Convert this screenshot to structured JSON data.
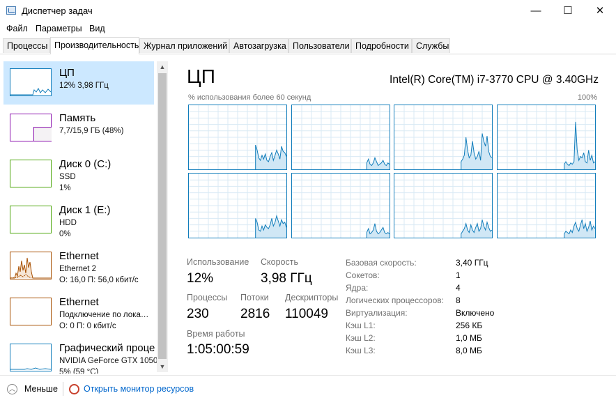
{
  "window": {
    "title": "Диспетчер задач",
    "minimize": "—",
    "maximize": "☐",
    "close": "✕"
  },
  "menu": [
    "Файл",
    "Параметры",
    "Вид"
  ],
  "tabs": [
    "Процессы",
    "Производительность",
    "Журнал приложений",
    "Автозагрузка",
    "Пользователи",
    "Подробности",
    "Службы"
  ],
  "active_tab": "Производительность",
  "sidebar": [
    {
      "title": "ЦП",
      "line1": "12% 3,98 ГГц",
      "line2": "",
      "color": "#117dbb",
      "selected": true
    },
    {
      "title": "Память",
      "line1": "7,7/15,9 ГБ (48%)",
      "line2": "",
      "color": "#8b12ae",
      "selected": false
    },
    {
      "title": "Диск 0 (C:)",
      "line1": "SSD",
      "line2": "1%",
      "color": "#4da60c",
      "selected": false
    },
    {
      "title": "Диск 1 (E:)",
      "line1": "HDD",
      "line2": "0%",
      "color": "#4da60c",
      "selected": false
    },
    {
      "title": "Ethernet",
      "line1": "Ethernet 2",
      "line2": "О: 16,0 П: 56,0 кбит/с",
      "color": "#a74f01",
      "selected": false
    },
    {
      "title": "Ethernet",
      "line1": "Подключение по лока…",
      "line2": "О: 0 П: 0 кбит/с",
      "color": "#a74f01",
      "selected": false
    },
    {
      "title": "Графический проце",
      "line1": "NVIDIA GeForce GTX 1050",
      "line2": "5% (59 °C)",
      "color": "#117dbb",
      "selected": false
    }
  ],
  "main": {
    "title": "ЦП",
    "model": "Intel(R) Core(TM) i7-3770 CPU @ 3.40GHz",
    "graph_caption": "% использования более 60 секунд",
    "graph_max": "100%",
    "stats": {
      "usage_label": "Использование",
      "usage_value": "12%",
      "speed_label": "Скорость",
      "speed_value": "3,98 ГГц",
      "processes_label": "Процессы",
      "processes_value": "230",
      "threads_label": "Потоки",
      "threads_value": "2816",
      "handles_label": "Дескрипторы",
      "handles_value": "110049",
      "uptime_label": "Время работы",
      "uptime_value": "1:05:00:59"
    },
    "details": [
      {
        "k": "Базовая скорость:",
        "v": "3,40 ГГц"
      },
      {
        "k": "Сокетов:",
        "v": "1"
      },
      {
        "k": "Ядра:",
        "v": "4"
      },
      {
        "k": "Логических процессоров:",
        "v": "8"
      },
      {
        "k": "Виртуализация:",
        "v": "Включено"
      },
      {
        "k": "Кэш L1:",
        "v": "256 КБ"
      },
      {
        "k": "Кэш L2:",
        "v": "1,0 МБ"
      },
      {
        "k": "Кэш L3:",
        "v": "8,0 МБ"
      }
    ]
  },
  "footer": {
    "less": "Меньше",
    "monitor": "Открыть монитор ресурсов"
  },
  "colors": {
    "cpu": "#117dbb",
    "memory": "#8b12ae",
    "disk": "#4da60c",
    "ethernet": "#a74f01",
    "selected_bg": "#cce8ff",
    "link": "#0066cc"
  },
  "core_usage_percent": [
    [
      0,
      0,
      0,
      0,
      0,
      0,
      0,
      0,
      0,
      0,
      0,
      0,
      0,
      0,
      0,
      0,
      0,
      0,
      0,
      0,
      0,
      0,
      0,
      0,
      0,
      0,
      0,
      0,
      0,
      0,
      0,
      0,
      0,
      0,
      0,
      0,
      0,
      0,
      0,
      0,
      0,
      38,
      30,
      18,
      14,
      22,
      16,
      24,
      14,
      12,
      20,
      26,
      14,
      22,
      30,
      24,
      16,
      36,
      28,
      26,
      20
    ],
    [
      0,
      0,
      0,
      0,
      0,
      0,
      0,
      0,
      0,
      0,
      0,
      0,
      0,
      0,
      0,
      0,
      0,
      0,
      0,
      0,
      0,
      0,
      0,
      0,
      0,
      0,
      0,
      0,
      0,
      0,
      0,
      0,
      0,
      0,
      0,
      0,
      0,
      0,
      0,
      0,
      0,
      0,
      0,
      0,
      0,
      0,
      10,
      16,
      8,
      6,
      10,
      18,
      12,
      6,
      8,
      10,
      14,
      8,
      6,
      10,
      8
    ],
    [
      0,
      0,
      0,
      0,
      0,
      0,
      0,
      0,
      0,
      0,
      0,
      0,
      0,
      0,
      0,
      0,
      0,
      0,
      0,
      0,
      0,
      0,
      0,
      0,
      0,
      0,
      0,
      0,
      0,
      0,
      0,
      0,
      0,
      0,
      0,
      0,
      0,
      0,
      0,
      0,
      0,
      12,
      16,
      22,
      50,
      30,
      18,
      22,
      44,
      26,
      16,
      20,
      28,
      14,
      56,
      44,
      36,
      52,
      28,
      20,
      18
    ],
    [
      0,
      0,
      0,
      0,
      0,
      0,
      0,
      0,
      0,
      0,
      0,
      0,
      0,
      0,
      0,
      0,
      0,
      0,
      0,
      0,
      0,
      0,
      0,
      0,
      0,
      0,
      0,
      0,
      0,
      0,
      0,
      0,
      0,
      0,
      0,
      0,
      0,
      0,
      0,
      0,
      0,
      8,
      12,
      8,
      6,
      10,
      8,
      12,
      74,
      30,
      14,
      20,
      18,
      26,
      12,
      10,
      30,
      14,
      22,
      10,
      12
    ],
    [
      0,
      0,
      0,
      0,
      0,
      0,
      0,
      0,
      0,
      0,
      0,
      0,
      0,
      0,
      0,
      0,
      0,
      0,
      0,
      0,
      0,
      0,
      0,
      0,
      0,
      0,
      0,
      0,
      0,
      0,
      0,
      0,
      0,
      0,
      0,
      0,
      0,
      0,
      0,
      0,
      0,
      30,
      24,
      12,
      10,
      18,
      12,
      20,
      16,
      14,
      20,
      30,
      18,
      24,
      34,
      26,
      18,
      28,
      22,
      24,
      16
    ],
    [
      0,
      0,
      0,
      0,
      0,
      0,
      0,
      0,
      0,
      0,
      0,
      0,
      0,
      0,
      0,
      0,
      0,
      0,
      0,
      0,
      0,
      0,
      0,
      0,
      0,
      0,
      0,
      0,
      0,
      0,
      0,
      0,
      0,
      0,
      0,
      0,
      0,
      0,
      0,
      0,
      0,
      0,
      0,
      0,
      0,
      0,
      8,
      14,
      6,
      8,
      12,
      22,
      10,
      6,
      8,
      12,
      16,
      8,
      6,
      8,
      6
    ],
    [
      0,
      0,
      0,
      0,
      0,
      0,
      0,
      0,
      0,
      0,
      0,
      0,
      0,
      0,
      0,
      0,
      0,
      0,
      0,
      0,
      0,
      0,
      0,
      0,
      0,
      0,
      0,
      0,
      0,
      0,
      0,
      0,
      0,
      0,
      0,
      0,
      0,
      0,
      0,
      0,
      0,
      6,
      10,
      14,
      22,
      12,
      8,
      20,
      12,
      8,
      16,
      22,
      10,
      14,
      28,
      18,
      12,
      24,
      16,
      10,
      12
    ],
    [
      0,
      0,
      0,
      0,
      0,
      0,
      0,
      0,
      0,
      0,
      0,
      0,
      0,
      0,
      0,
      0,
      0,
      0,
      0,
      0,
      0,
      0,
      0,
      0,
      0,
      0,
      0,
      0,
      0,
      0,
      0,
      0,
      0,
      0,
      0,
      0,
      0,
      0,
      0,
      0,
      0,
      6,
      10,
      8,
      6,
      12,
      8,
      18,
      24,
      14,
      10,
      20,
      28,
      14,
      22,
      10,
      16,
      26,
      12,
      18,
      14
    ]
  ]
}
